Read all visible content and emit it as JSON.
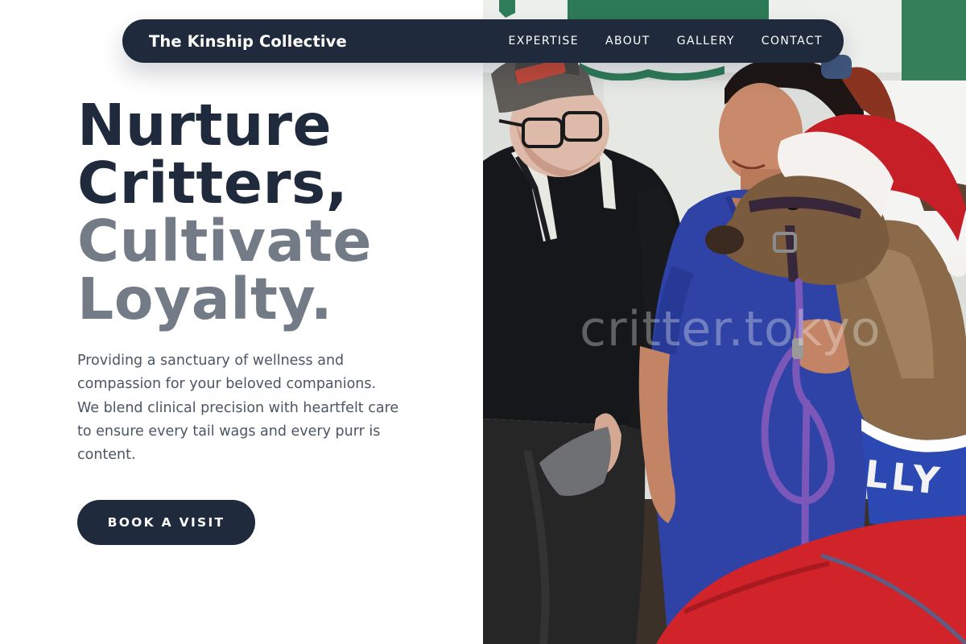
{
  "nav": {
    "brand": "The Kinship Collective",
    "links": [
      "EXPERTISE",
      "ABOUT",
      "GALLERY",
      "CONTACT"
    ]
  },
  "hero": {
    "headline_line1": "Nurture",
    "headline_line2": "Critters,",
    "headline_line3": "Cultivate",
    "headline_line4": "Loyalty.",
    "description": "Providing a sanctuary of wellness and compassion for your beloved companions. We blend clinical precision with heartfelt care to ensure every tail wags and every purr is content.",
    "cta_label": "BOOK A VISIT"
  },
  "photo": {
    "watermark": "critter.tokyo",
    "subject": "elderly man in cap, nurse in blue scrubs and alpaca in santa hat with purple lead",
    "blanket_lettering": "LLY"
  },
  "colors": {
    "navy": "#1f2a3c",
    "muted_gray": "#737b86",
    "body_text": "#4b5563",
    "scrubs_blue": "#2f43a6",
    "santa_red": "#d0242a",
    "lead_purple": "#7a57b8"
  }
}
